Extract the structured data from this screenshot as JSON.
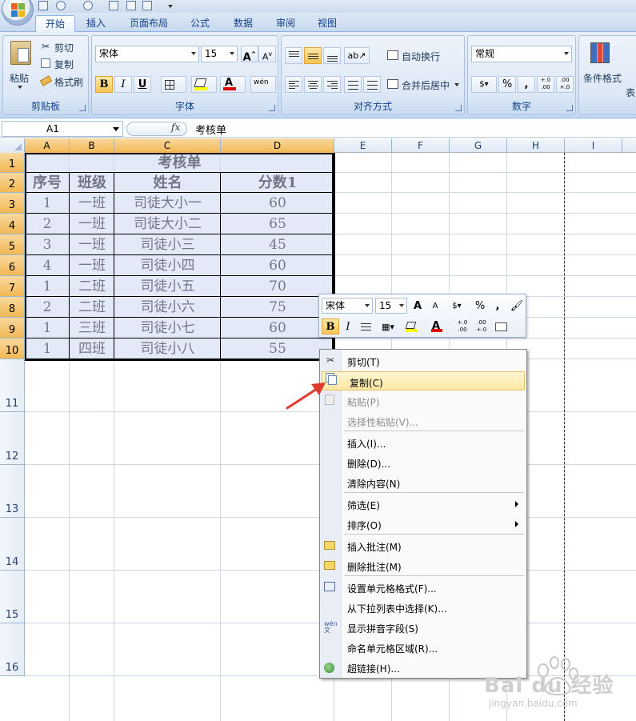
{
  "quick_access": {},
  "tabs": [
    "开始",
    "插入",
    "页面布局",
    "公式",
    "数据",
    "审阅",
    "视图"
  ],
  "clipboard": {
    "paste": "粘贴",
    "cut": "剪切",
    "copy": "复制",
    "format_painter": "格式刷",
    "label": "剪贴板"
  },
  "font": {
    "name": "宋体",
    "size": "15",
    "grow": "A",
    "shrink": "A",
    "bold": "B",
    "italic": "I",
    "underline": "U",
    "font_color": "A",
    "phonetic": "wén",
    "label": "字体"
  },
  "alignment": {
    "wrap": "自动换行",
    "merge": "合并后居中",
    "label": "对齐方式"
  },
  "number": {
    "format": "常规",
    "percent": "%",
    "comma": ",",
    "inc": "+.0 .00",
    "dec": ".00 +.0",
    "label": "数字"
  },
  "styles": {
    "conditional": "条件格式",
    "table": "表"
  },
  "formula_bar": {
    "name_box": "A1",
    "fx": "fx",
    "formula": "考核单"
  },
  "columns": [
    "A",
    "B",
    "C",
    "D",
    "E",
    "F",
    "G",
    "H",
    "I"
  ],
  "rows": [
    "1",
    "2",
    "3",
    "4",
    "5",
    "6",
    "7",
    "8",
    "9",
    "10",
    "11",
    "12",
    "13",
    "14",
    "15",
    "16"
  ],
  "sheet": {
    "title": "考核单",
    "headers": [
      "序号",
      "班级",
      "姓名",
      "分数1"
    ],
    "data": [
      [
        "1",
        "一班",
        "司徒大小一",
        "60"
      ],
      [
        "2",
        "一班",
        "司徒大小二",
        "65"
      ],
      [
        "3",
        "一班",
        "司徒小三",
        "45"
      ],
      [
        "4",
        "一班",
        "司徒小四",
        "60"
      ],
      [
        "1",
        "二班",
        "司徒小五",
        "70"
      ],
      [
        "2",
        "二班",
        "司徒小六",
        "75"
      ],
      [
        "1",
        "三班",
        "司徒小七",
        "60"
      ],
      [
        "1",
        "四班",
        "司徒小八",
        "55"
      ]
    ]
  },
  "mini_toolbar": {
    "font": "宋体",
    "size": "15",
    "percent": "%",
    "comma": ",",
    "bold": "B",
    "italic": "I"
  },
  "context_menu": {
    "items": [
      {
        "label": "剪切(T)",
        "icon": "scissors-icon",
        "disabled": false
      },
      {
        "label": "复制(C)",
        "icon": "copy-icon",
        "disabled": false,
        "highlighted": true
      },
      {
        "label": "粘贴(P)",
        "icon": "paste-icon",
        "disabled": true
      },
      {
        "label": "选择性粘贴(V)...",
        "disabled": true
      },
      {
        "label": "插入(I)...",
        "disabled": false
      },
      {
        "label": "删除(D)...",
        "disabled": false
      },
      {
        "label": "清除内容(N)",
        "disabled": false
      },
      {
        "label": "筛选(E)",
        "disabled": false,
        "submenu": true
      },
      {
        "label": "排序(O)",
        "disabled": false,
        "submenu": true
      },
      {
        "label": "插入批注(M)",
        "icon": "insert-comment-icon",
        "disabled": false
      },
      {
        "label": "删除批注(M)",
        "icon": "delete-comment-icon",
        "disabled": false
      },
      {
        "label": "设置单元格格式(F)...",
        "icon": "format-cells-icon",
        "disabled": false
      },
      {
        "label": "从下拉列表中选择(K)...",
        "disabled": false
      },
      {
        "label": "显示拼音字段(S)",
        "icon": "phonetic-icon",
        "disabled": false
      },
      {
        "label": "命名单元格区域(R)...",
        "disabled": false
      },
      {
        "label": "超链接(H)...",
        "icon": "hyperlink-icon",
        "disabled": false
      }
    ]
  },
  "colors": {
    "accent": "#e0a43a",
    "arrow": "#e03a2e",
    "ribbon": "#dbe7f5",
    "selection": "#cdd7f0"
  },
  "watermark": {
    "brand": "Bai du 经验",
    "url": "jingyan.baidu.com"
  }
}
